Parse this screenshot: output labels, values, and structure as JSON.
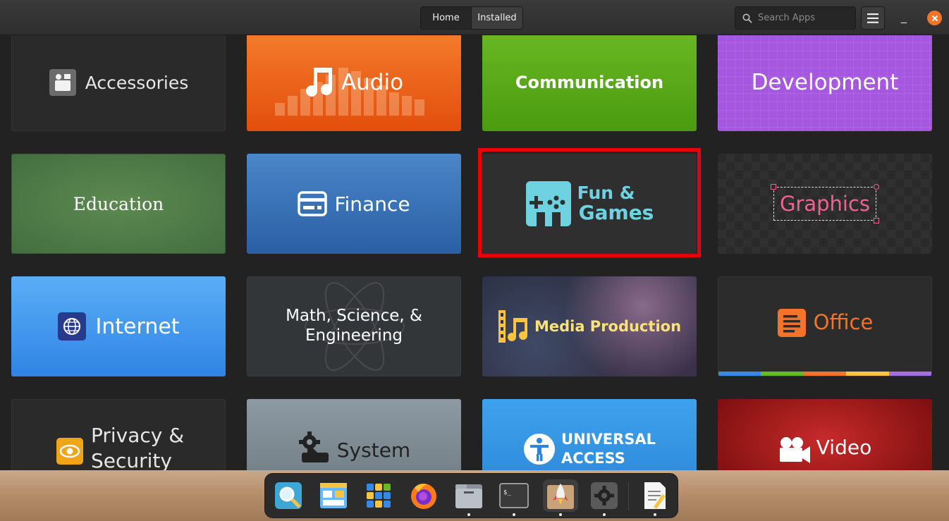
{
  "header": {
    "tabs": [
      {
        "label": "Home"
      },
      {
        "label": "Installed"
      }
    ],
    "search_placeholder": "Search Apps",
    "minimize_label": "_",
    "close_label": "×"
  },
  "categories": {
    "accessories": "Accessories",
    "audio": "Audio",
    "communication": "Communication",
    "development": "Development",
    "education": "Education",
    "finance": "Finance",
    "fun_line1": "Fun &",
    "fun_line2": "Games",
    "graphics": "Graphics",
    "internet": "Internet",
    "math_line1": "Math, Science, &",
    "math_line2": "Engineering",
    "media": "Media Production",
    "office": "Office",
    "privacy_line1": "Privacy &",
    "privacy_line2": "Security",
    "system": "System",
    "universal_line1": "UNIVERSAL",
    "universal_line2": "ACCESS",
    "video": "Video"
  },
  "colors": {
    "highlight": "#e8000a",
    "office_stripe": [
      "#3689e6",
      "#68b723",
      "#f37329",
      "#f9c440",
      "#a56de2"
    ]
  },
  "dock": {
    "items": [
      {
        "icon": "magnifier-app-icon",
        "running": false
      },
      {
        "icon": "app-store-window-icon",
        "running": false
      },
      {
        "icon": "app-grid-icon",
        "running": false
      },
      {
        "icon": "firefox-icon",
        "running": false
      },
      {
        "icon": "files-icon",
        "running": true
      },
      {
        "icon": "terminal-icon",
        "running": true
      },
      {
        "icon": "appcenter-rocket-icon",
        "running": true
      },
      {
        "icon": "settings-gear-icon",
        "running": true
      },
      {
        "icon": "text-editor-icon",
        "running": true
      }
    ],
    "terminal_prompt": "$_"
  }
}
